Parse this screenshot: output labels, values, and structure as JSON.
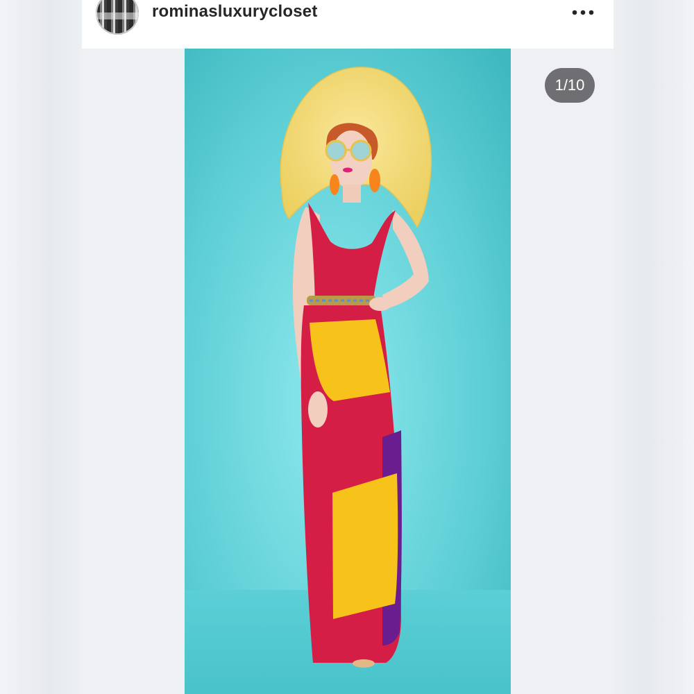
{
  "post": {
    "username": "rominasluxurycloset",
    "more_icon": "more-horizontal-icon",
    "counter": "1/10"
  },
  "colors": {
    "background_teal": "#5fd0d6",
    "hat_yellow": "#f6de73",
    "dress_red": "#d51e45",
    "dress_yellow": "#f7c21a",
    "dress_purple": "#6a1d8f",
    "counter_bg": "#6f6f73"
  }
}
